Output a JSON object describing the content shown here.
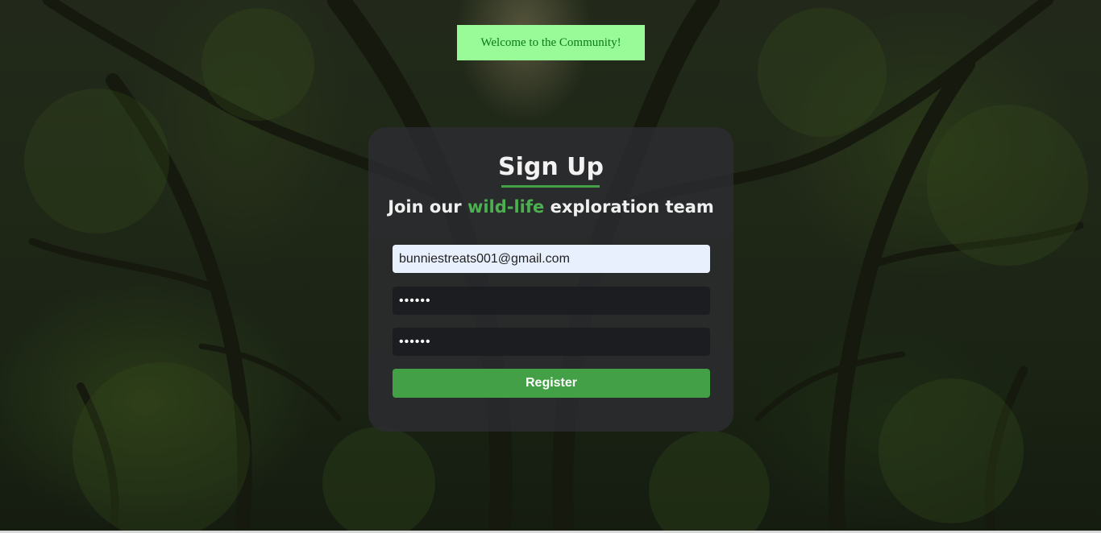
{
  "banner": {
    "text": "Welcome to the Community!",
    "background_color": "#98fb98",
    "text_color": "#0a7a1a"
  },
  "signup": {
    "title": "Sign Up",
    "subtitle_before": "Join our ",
    "subtitle_highlight": "wild-life",
    "subtitle_after": " exploration team",
    "accent_color": "#43a047"
  },
  "form": {
    "email_value": "bunniestreats001@gmail.com",
    "password_value": "••••••",
    "confirm_password_value": "••••••",
    "register_label": "Register"
  },
  "background": {
    "icon": "forest-background-image"
  }
}
